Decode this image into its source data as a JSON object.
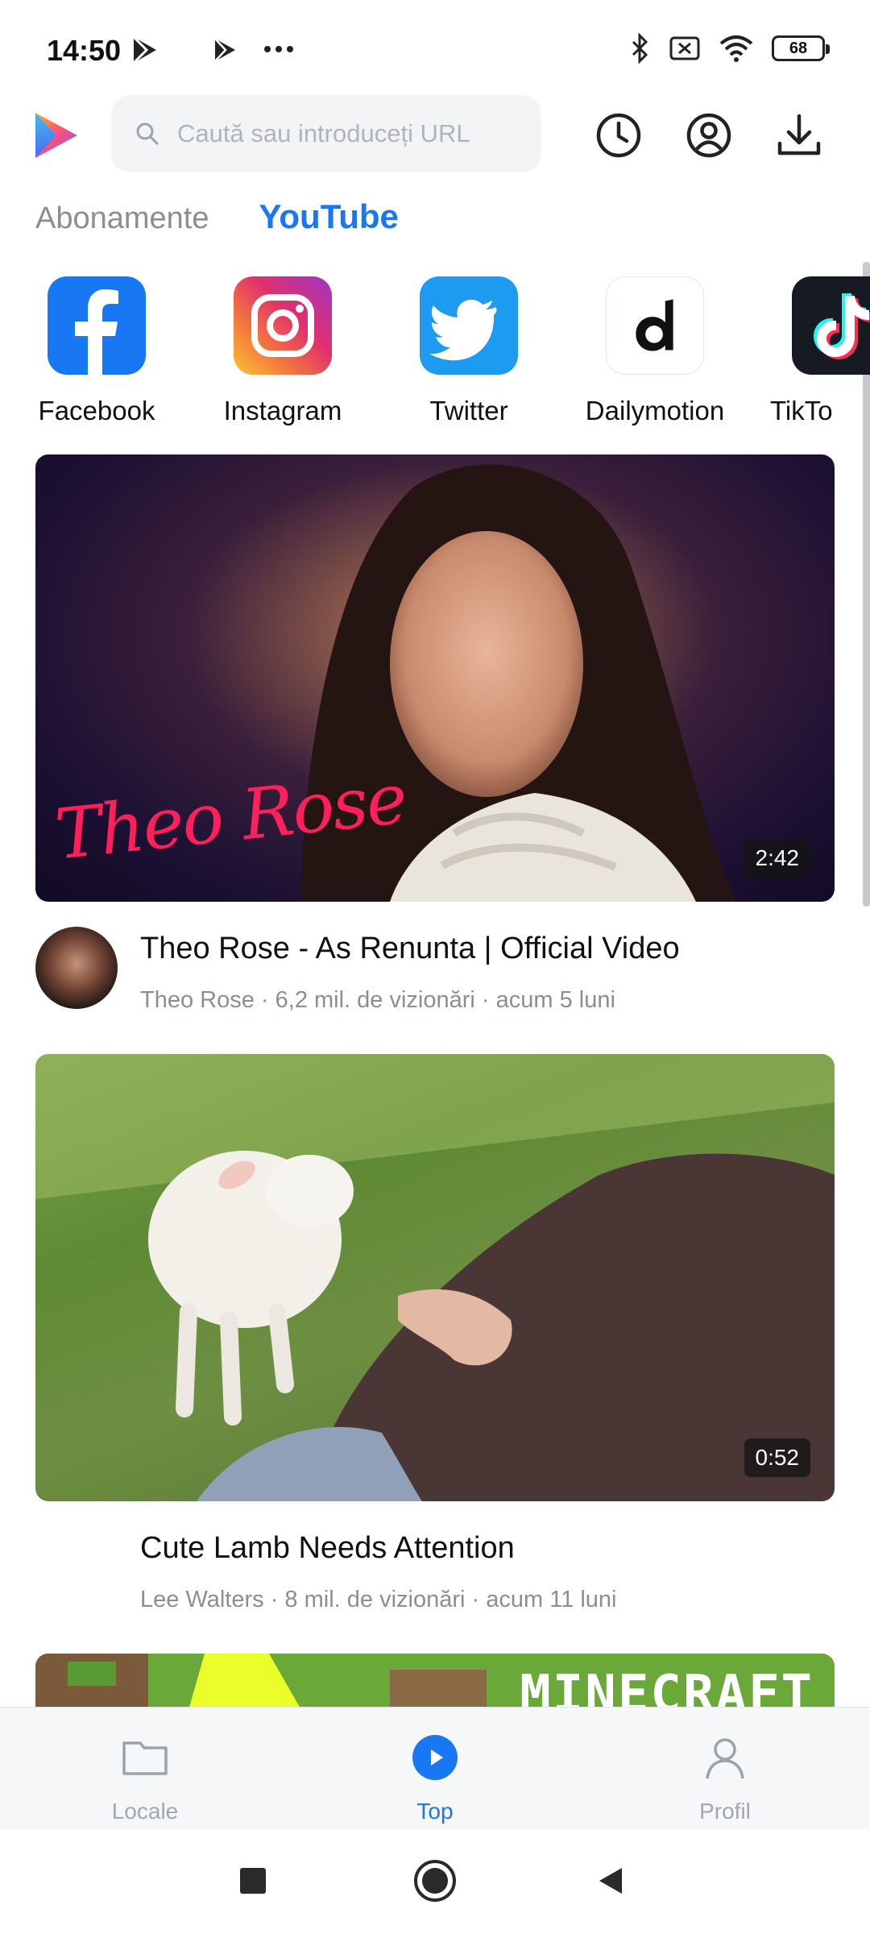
{
  "status_bar": {
    "time": "14:50",
    "battery": "68",
    "icons": [
      "play-store-icon",
      "play-icon",
      "more-dots-icon",
      "bluetooth-icon",
      "sim-off-icon",
      "wifi-icon",
      "battery-icon"
    ]
  },
  "header": {
    "logo": "app-logo",
    "search_placeholder": "Caută sau introduceți URL",
    "icons": [
      "history-icon",
      "account-icon",
      "download-icon"
    ]
  },
  "tabs": [
    {
      "label": "Abonamente",
      "active": false
    },
    {
      "label": "YouTube",
      "active": true
    }
  ],
  "sites": [
    {
      "label": "Facebook",
      "icon": "facebook-icon",
      "color": "#1877f2"
    },
    {
      "label": "Instagram",
      "icon": "instagram-icon",
      "color": "#e1306c"
    },
    {
      "label": "Twitter",
      "icon": "twitter-icon",
      "color": "#1d9bf0"
    },
    {
      "label": "Dailymotion",
      "icon": "dailymotion-icon",
      "color": "#ffffff"
    },
    {
      "label": "TikTo",
      "icon": "tiktok-icon",
      "color": "#111111"
    }
  ],
  "videos": [
    {
      "title": "Theo Rose - As Renunta | Official Video",
      "meta": "Theo Rose · 6,2 mil. de vizionări · acum 5 luni",
      "duration": "2:42",
      "thumb_text": "Theo Rose"
    },
    {
      "title": "Cute Lamb Needs Attention",
      "meta": "Lee Walters · 8 mil. de vizionări · acum 11 luni",
      "duration": "0:52"
    },
    {
      "thumb_text": "MINECRAFT"
    }
  ],
  "bottom_nav": [
    {
      "label": "Locale",
      "icon": "folder-icon",
      "active": false
    },
    {
      "label": "Top",
      "icon": "play-circle-icon",
      "active": true
    },
    {
      "label": "Profil",
      "icon": "person-icon",
      "active": false
    }
  ],
  "system_nav": [
    "recents-icon",
    "home-icon",
    "back-icon"
  ],
  "colors": {
    "accent": "#1877f2",
    "muted_text": "#8a8f96",
    "search_bg": "#f3f4f6"
  }
}
